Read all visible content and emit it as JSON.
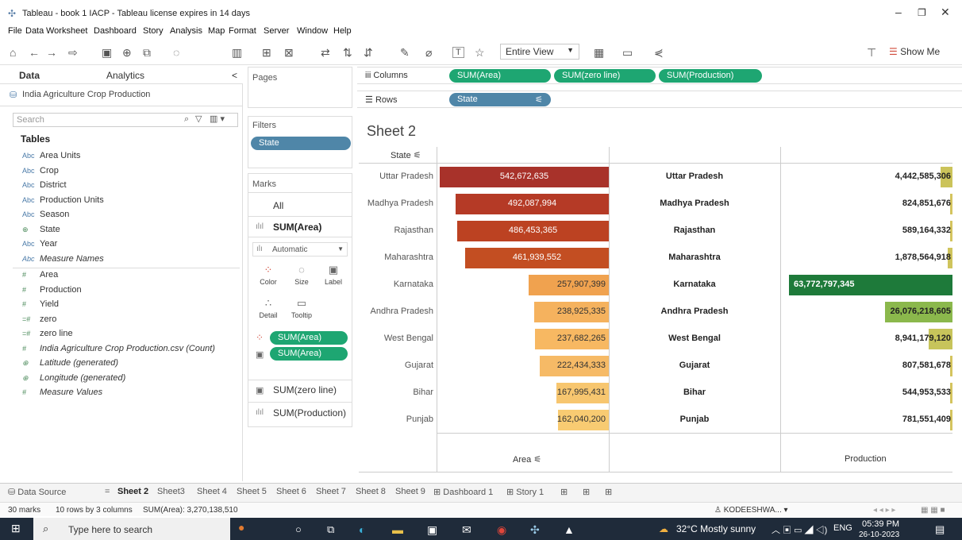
{
  "window": {
    "title": "Tableau - book 1 IACP - Tableau license expires in 14 days",
    "controls": [
      "–",
      "❐",
      "✕"
    ]
  },
  "menu": [
    "File",
    "Data",
    "Worksheet",
    "Dashboard",
    "Story",
    "Analysis",
    "Map",
    "Format",
    "Server",
    "Window",
    "Help"
  ],
  "toolbar": {
    "fit_select": "Entire View",
    "show_me": "Show Me"
  },
  "data_panel": {
    "tab_data": "Data",
    "tab_analytics": "Analytics",
    "collapse": "<",
    "data_source": "India Agriculture Crop Production",
    "search_placeholder": "Search",
    "tables_heading": "Tables",
    "dimensions": [
      {
        "icon": "Abc",
        "name": "Area Units"
      },
      {
        "icon": "Abc",
        "name": "Crop"
      },
      {
        "icon": "Abc",
        "name": "District"
      },
      {
        "icon": "Abc",
        "name": "Production Units"
      },
      {
        "icon": "Abc",
        "name": "Season"
      },
      {
        "icon": "⊕",
        "name": "State"
      },
      {
        "icon": "Abc",
        "name": "Year"
      },
      {
        "icon": "Abc",
        "name": "Measure Names"
      }
    ],
    "measures": [
      {
        "icon": "#",
        "name": "Area"
      },
      {
        "icon": "#",
        "name": "Production"
      },
      {
        "icon": "#",
        "name": "Yield"
      },
      {
        "icon": "=#",
        "name": "zero"
      },
      {
        "icon": "=#",
        "name": "zero line"
      },
      {
        "icon": "#",
        "name": "India Agriculture Crop Production.csv (Count)"
      },
      {
        "icon": "⊕",
        "name": "Latitude (generated)"
      },
      {
        "icon": "⊕",
        "name": "Longitude (generated)"
      },
      {
        "icon": "#",
        "name": "Measure Values"
      }
    ]
  },
  "cards": {
    "pages": "Pages",
    "filters": "Filters",
    "filter_pill": "State",
    "marks": "Marks",
    "marks_all": "All",
    "marks_sum_area": "SUM(Area)",
    "mark_type": "Automatic",
    "mark_buttons": [
      "Color",
      "Size",
      "Label",
      "Detail",
      "Tooltip"
    ],
    "mark_pills": [
      "SUM(Area)",
      "SUM(Area)"
    ],
    "marks_zero_line": "SUM(zero line)",
    "marks_production": "SUM(Production)"
  },
  "shelves": {
    "columns_label": "Columns",
    "rows_label": "Rows",
    "columns": [
      "SUM(Area)",
      "SUM(zero line)",
      "SUM(Production)"
    ],
    "rows": [
      "State"
    ]
  },
  "sheet": {
    "title": "Sheet 2",
    "state_header": "State"
  },
  "chart_data": {
    "type": "bar",
    "categories": [
      "Uttar Pradesh",
      "Madhya Pradesh",
      "Rajasthan",
      "Maharashtra",
      "Karnataka",
      "Andhra Pradesh",
      "West Bengal",
      "Gujarat",
      "Bihar",
      "Punjab"
    ],
    "area": [
      542672635,
      492087994,
      486453365,
      461939552,
      257907399,
      238925335,
      237682265,
      222434333,
      167995431,
      162040200
    ],
    "area_labels": [
      "542,672,635",
      "492,087,994",
      "486,453,365",
      "461,939,552",
      "257,907,399",
      "238,925,335",
      "237,682,265",
      "222,434,333",
      "167,995,431",
      "162,040,200"
    ],
    "production": [
      4442585306,
      824851676,
      589164332,
      1878564918,
      63772797345,
      26076218605,
      8941179120,
      807581678,
      544953533,
      781551409
    ],
    "production_labels": [
      "4,442,585,306",
      "824,851,676",
      "589,164,332",
      "1,878,564,918",
      "63,772,797,345",
      "26,076,218,605",
      "8,941,179,120",
      "807,581,678",
      "544,953,533",
      "781,551,409"
    ],
    "area_colors": [
      "#a8322a",
      "#b53a26",
      "#bc4222",
      "#c34e22",
      "#f0a24f",
      "#f5b25e",
      "#f7b862",
      "#f6ba66",
      "#f7c66f",
      "#f8cb72"
    ],
    "production_colors": [
      "#cbc35a",
      "#d4c45e",
      "#d4c45e",
      "#cfc45c",
      "#1e7a3a",
      "#8bb84c",
      "#c7c45b",
      "#d4c45e",
      "#d4c45e",
      "#d4c45e"
    ],
    "xlabel_area": "Area",
    "xlabel_production": "Production"
  },
  "tabs": {
    "data_source": "Data Source",
    "sheets": [
      "Sheet 2",
      "Sheet3",
      "Sheet 4",
      "Sheet 5",
      "Sheet 6",
      "Sheet 7",
      "Sheet 8",
      "Sheet 9",
      "Dashboard 1",
      "Story 1"
    ],
    "active": "Sheet 2"
  },
  "status": {
    "marks": "30 marks",
    "rows": "10 rows by 3 columns",
    "sum": "SUM(Area): 3,270,138,510",
    "user": "KODEESHWA..."
  },
  "taskbar": {
    "search_placeholder": "Type here to search",
    "weather": "32°C  Mostly sunny",
    "lang": "ENG",
    "time": "05:39 PM",
    "date": "26-10-2023"
  }
}
